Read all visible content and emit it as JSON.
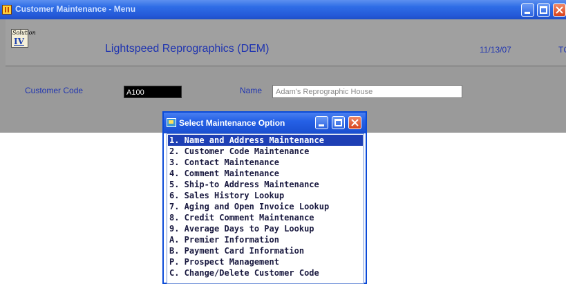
{
  "window": {
    "title": "Customer Maintenance - Menu",
    "icon": "app-grid-icon",
    "controls": [
      "minimize-icon",
      "maximize-icon",
      "close-icon"
    ]
  },
  "header": {
    "logo_top": "Solution",
    "logo_num": "IV",
    "company": "Lightspeed Reprographics (DEM)",
    "date": "11/13/07",
    "extra": "TC"
  },
  "form": {
    "customer_code_label": "Customer Code",
    "customer_code_value": "A100",
    "name_label": "Name",
    "name_value": "Adam's Reprographic House"
  },
  "dialog": {
    "title": "Select Maintenance Option",
    "items": [
      "1. Name and Address Maintenance",
      "2. Customer Code Maintenance",
      "3. Contact Maintenance",
      "4. Comment Maintenance",
      "5. Ship-to Address Maintenance",
      "6. Sales History Lookup",
      "7. Aging and Open Invoice Lookup",
      "8. Credit Comment Maintenance",
      "9. Average Days to Pay Lookup",
      "A. Premier Information",
      "B. Payment Card Information",
      "P. Prospect Management",
      "C. Change/Delete Customer Code"
    ],
    "selected_index": 0
  },
  "colors": {
    "titlebar": "#2459d8",
    "label_text": "#1f34b0",
    "selection": "#1e3fb4",
    "panel": "#9a9a9a"
  }
}
